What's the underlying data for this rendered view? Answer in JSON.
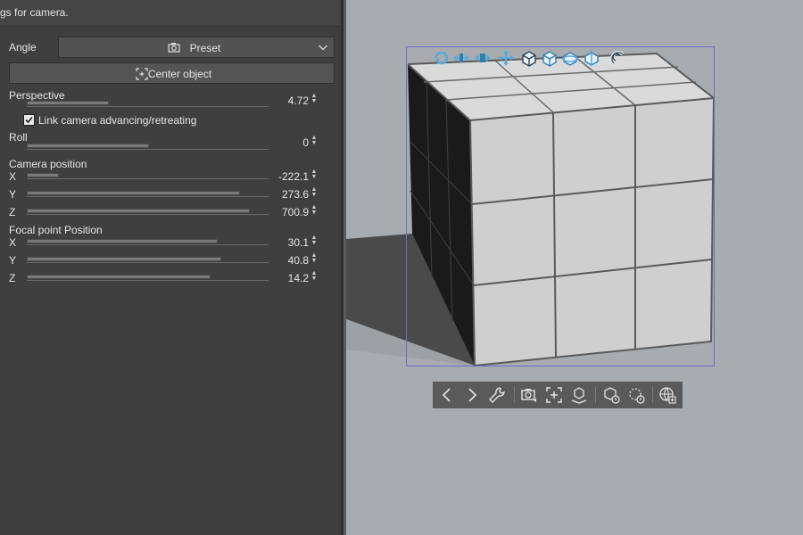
{
  "panel": {
    "hint": "gs for camera.",
    "angle": {
      "label": "Angle",
      "value": "Preset"
    },
    "center_button": "Center object",
    "perspective": {
      "label": "Perspective",
      "value": "4.72",
      "level": 0.33
    },
    "link_camera": {
      "label": "Link camera advancing/retreating",
      "checked": true
    },
    "roll": {
      "label": "Roll",
      "value": "0",
      "level": 0.5
    },
    "camera_position": {
      "label": "Camera position",
      "x": {
        "label": "X",
        "value": "-222.1",
        "level": 0.13
      },
      "y": {
        "label": "Y",
        "value": "273.6",
        "level": 0.88
      },
      "z": {
        "label": "Z",
        "value": "700.9",
        "level": 0.92
      }
    },
    "focal_point": {
      "label": "Focal point Position",
      "x": {
        "label": "X",
        "value": "30.1",
        "level": 0.79
      },
      "y": {
        "label": "Y",
        "value": "40.8",
        "level": 0.8
      },
      "z": {
        "label": "Z",
        "value": "14.2",
        "level": 0.76
      }
    }
  },
  "colors": {
    "panel_bg": "#3f3f3f",
    "viewport_bg": "#a8acaf",
    "cube_face_light": "#d8d8d8",
    "cube_face_dark": "#1c1c1c",
    "accent_icon": "#5aaad8",
    "selection_box": "#6a6acc"
  },
  "manipulator_icons": [
    "rotate-icon",
    "move-horizontal-icon",
    "move-depth-icon",
    "move-all-icon",
    "rotate-3d-icon",
    "rotate-x-icon",
    "rotate-y-icon",
    "rotate-z-icon",
    "snap-magnet-icon"
  ],
  "toolbar_icons": [
    "previous-icon",
    "next-icon",
    "wrench-icon",
    "camera-angle-icon",
    "center-object-icon",
    "ground-icon",
    "reset-rotation-icon",
    "rotate-reset-icon",
    "world-icon"
  ]
}
